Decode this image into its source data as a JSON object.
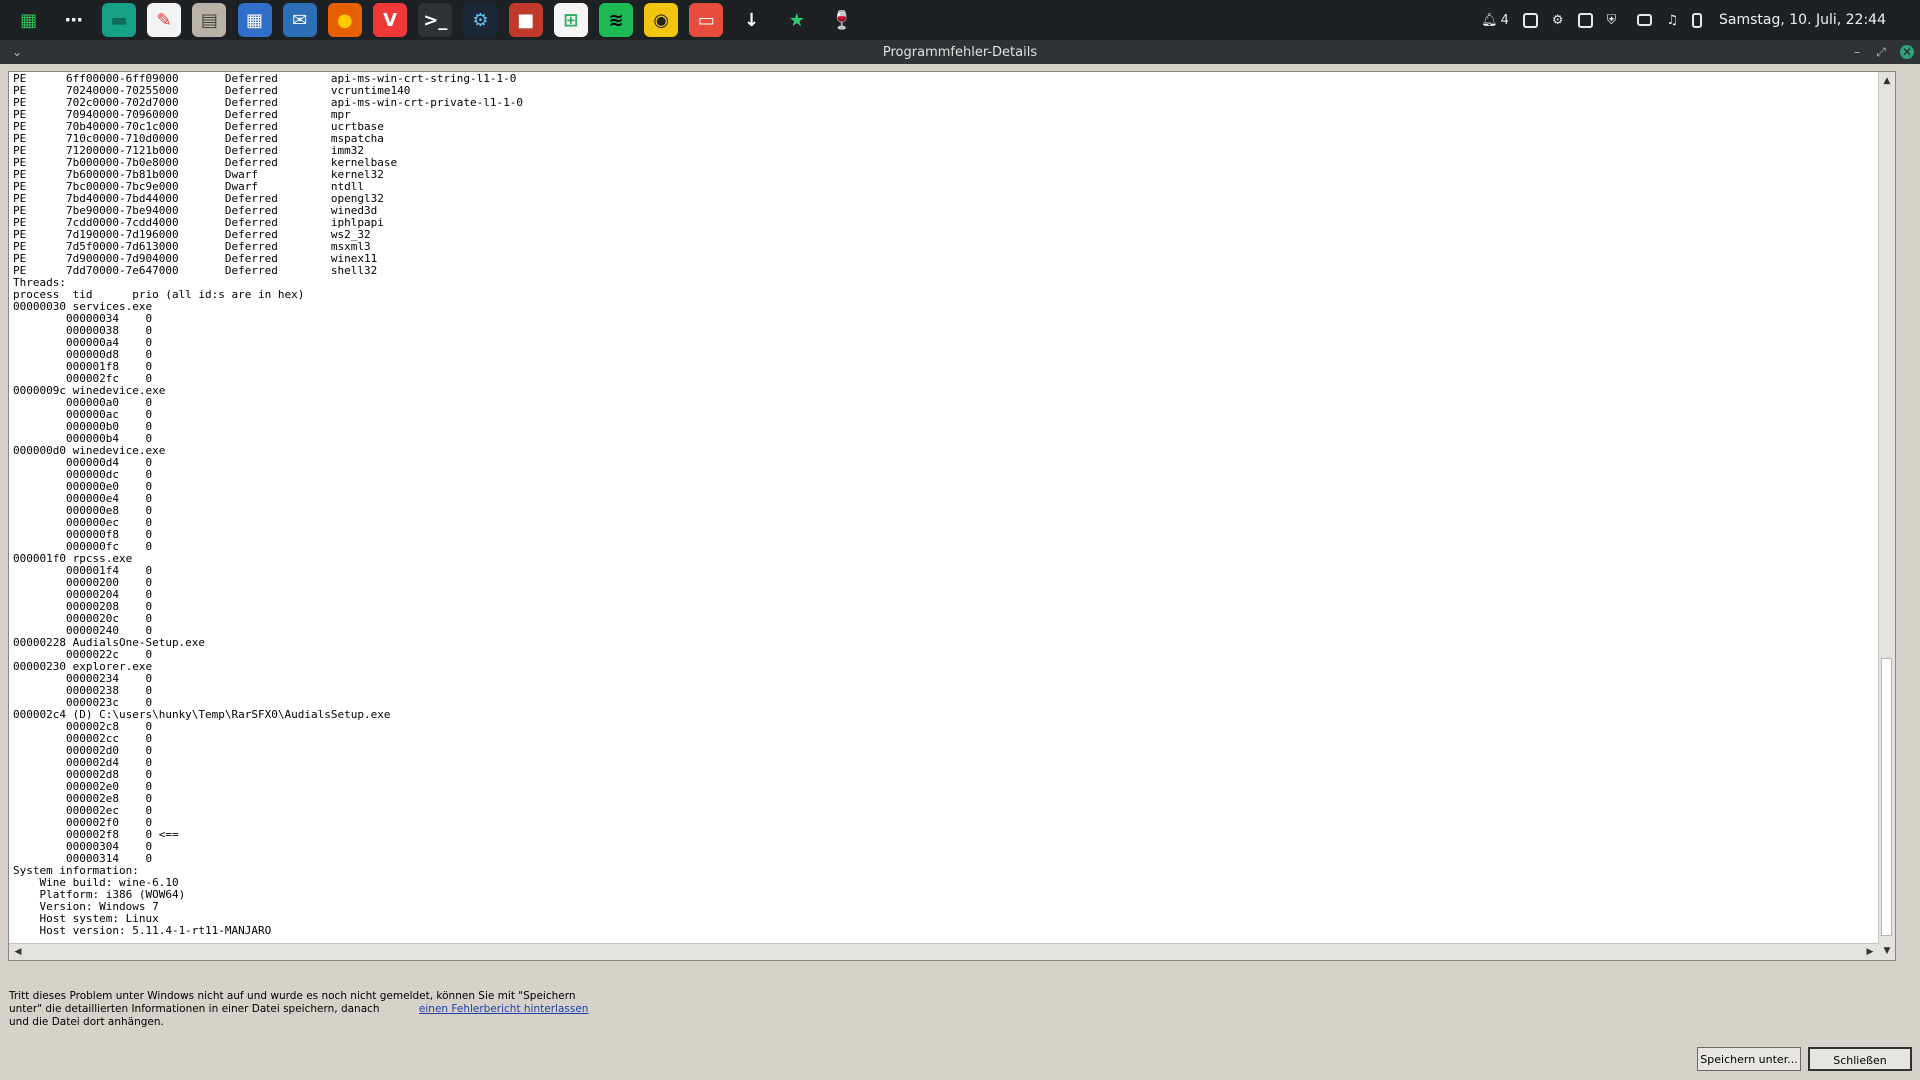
{
  "panel": {
    "apps": [
      {
        "name": "manjaro-menu-icon",
        "glyph": "▦",
        "bg": "#1e2124",
        "fg": "#35bf5c"
      },
      {
        "name": "show-desktop-icon",
        "glyph": "⋯",
        "bg": "#1e2124",
        "fg": "#ffffff"
      },
      {
        "name": "files-green-icon",
        "glyph": "▬",
        "bg": "#16a085",
        "fg": "#0f6b5a"
      },
      {
        "name": "text-editor-icon",
        "glyph": "✎",
        "bg": "#f2f2f2",
        "fg": "#d33"
      },
      {
        "name": "file-manager-icon",
        "glyph": "▤",
        "bg": "#b9b2a6",
        "fg": "#444"
      },
      {
        "name": "calculator-icon",
        "glyph": "▦",
        "bg": "#2f6fc9",
        "fg": "#ffffff"
      },
      {
        "name": "thunderbird-icon",
        "glyph": "✉",
        "bg": "#2c6fb7",
        "fg": "#ffffff"
      },
      {
        "name": "firefox-icon",
        "glyph": "●",
        "bg": "#e66000",
        "fg": "#ffcb00"
      },
      {
        "name": "vivaldi-icon",
        "glyph": "V",
        "bg": "#ef3939",
        "fg": "#ffffff"
      },
      {
        "name": "terminal-icon",
        "glyph": ">_",
        "bg": "#2e3436",
        "fg": "#ffffff"
      },
      {
        "name": "steam-icon",
        "glyph": "⚙",
        "bg": "#1b2838",
        "fg": "#66c0f4"
      },
      {
        "name": "screen-recorder-icon",
        "glyph": "■",
        "bg": "#c0392b",
        "fg": "#ffffff"
      },
      {
        "name": "software-store-icon",
        "glyph": "⊞",
        "bg": "#f5f5f5",
        "fg": "#27ae60"
      },
      {
        "name": "spotify-icon",
        "glyph": "≋",
        "bg": "#1db954",
        "fg": "#000000"
      },
      {
        "name": "speaker-icon",
        "glyph": "◉",
        "bg": "#f1c40f",
        "fg": "#222"
      },
      {
        "name": "image-viewer-icon",
        "glyph": "▭",
        "bg": "#e74c3c",
        "fg": "#ffffff"
      },
      {
        "name": "downloader-icon",
        "glyph": "↓",
        "bg": "#1e2124",
        "fg": "#ffffff"
      },
      {
        "name": "star-app-icon",
        "glyph": "★",
        "bg": "#1e2124",
        "fg": "#2ecc71"
      },
      {
        "name": "wine-icon",
        "glyph": "🍷",
        "bg": "#1e2124",
        "fg": "#c0392b"
      }
    ],
    "tray": {
      "notification_count": "4",
      "clock": "Samstag, 10. Juli, 22:44"
    }
  },
  "window": {
    "title": "Programmfehler-Details",
    "log_lines": [
      "PE      6ff00000-6ff09000       Deferred        api-ms-win-crt-string-l1-1-0",
      "PE      70240000-70255000       Deferred        vcruntime140",
      "PE      702c0000-702d7000       Deferred        api-ms-win-crt-private-l1-1-0",
      "PE      70940000-70960000       Deferred        mpr",
      "PE      70b40000-70c1c000       Deferred        ucrtbase",
      "PE      710c0000-710d0000       Deferred        mspatcha",
      "PE      71200000-7121b000       Deferred        imm32",
      "PE      7b000000-7b0e8000       Deferred        kernelbase",
      "PE      7b600000-7b81b000       Dwarf           kernel32",
      "PE      7bc00000-7bc9e000       Dwarf           ntdll",
      "PE      7bd40000-7bd44000       Deferred        opengl32",
      "PE      7be90000-7be94000       Deferred        wined3d",
      "PE      7cdd0000-7cdd4000       Deferred        iphlpapi",
      "PE      7d190000-7d196000       Deferred        ws2_32",
      "PE      7d5f0000-7d613000       Deferred        msxml3",
      "PE      7d900000-7d904000       Deferred        winex11",
      "PE      7dd70000-7e647000       Deferred        shell32",
      "Threads:",
      "process  tid      prio (all id:s are in hex)",
      "00000030 services.exe",
      "        00000034    0",
      "        00000038    0",
      "        000000a4    0",
      "        000000d8    0",
      "        000001f8    0",
      "        000002fc    0",
      "0000009c winedevice.exe",
      "        000000a0    0",
      "        000000ac    0",
      "        000000b0    0",
      "        000000b4    0",
      "000000d0 winedevice.exe",
      "        000000d4    0",
      "        000000dc    0",
      "        000000e0    0",
      "        000000e4    0",
      "        000000e8    0",
      "        000000ec    0",
      "        000000f8    0",
      "        000000fc    0",
      "000001f0 rpcss.exe",
      "        000001f4    0",
      "        00000200    0",
      "        00000204    0",
      "        00000208    0",
      "        0000020c    0",
      "        00000240    0",
      "00000228 AudialsOne-Setup.exe",
      "        0000022c    0",
      "00000230 explorer.exe",
      "        00000234    0",
      "        00000238    0",
      "        0000023c    0",
      "000002c4 (D) C:\\users\\hunky\\Temp\\RarSFX0\\AudialsSetup.exe",
      "        000002c8    0",
      "        000002cc    0",
      "        000002d0    0",
      "        000002d4    0",
      "        000002d8    0",
      "        000002e0    0",
      "        000002e8    0",
      "        000002ec    0",
      "        000002f0    0",
      "        000002f8    0 <==",
      "        00000304    0",
      "        00000314    0",
      "System information:",
      "    Wine build: wine-6.10",
      "    Platform: i386 (WOW64)",
      "    Version: Windows 7",
      "    Host system: Linux",
      "    Host version: 5.11.4-1-rt11-MANJARO"
    ],
    "info_part1": "Tritt dieses Problem unter Windows nicht auf und wurde es noch nicht gemeldet, können Sie mit \"Speichern unter\" die detaillierten Informationen in einer Datei speichern, danach",
    "info_link": "einen Fehlerbericht hinterlassen",
    "info_part2": "und die Datei dort anhängen.",
    "save_button": "Speichern unter...",
    "close_button": "Schließen"
  }
}
